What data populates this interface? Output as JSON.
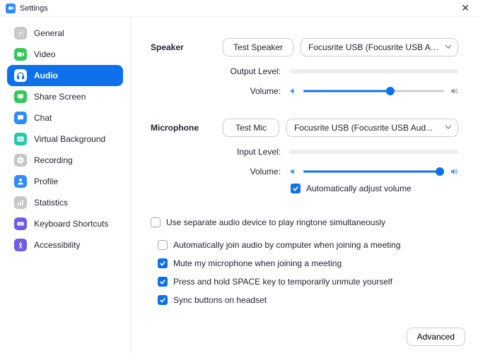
{
  "window": {
    "title": "Settings"
  },
  "sidebar": {
    "items": [
      {
        "label": "General",
        "icon": "gear",
        "color": "#C7C7C7"
      },
      {
        "label": "Video",
        "icon": "video",
        "color": "#34C759"
      },
      {
        "label": "Audio",
        "icon": "headphones",
        "color": "#fff"
      },
      {
        "label": "Share Screen",
        "icon": "share",
        "color": "#34C759"
      },
      {
        "label": "Chat",
        "icon": "chat",
        "color": "#2D8CFF"
      },
      {
        "label": "Virtual Background",
        "icon": "virtualbg",
        "color": "#23C9A9"
      },
      {
        "label": "Recording",
        "icon": "recording",
        "color": "#C7C7C7"
      },
      {
        "label": "Profile",
        "icon": "profile",
        "color": "#2D8CFF"
      },
      {
        "label": "Statistics",
        "icon": "statistics",
        "color": "#C7C7C7"
      },
      {
        "label": "Keyboard Shortcuts",
        "icon": "keyboard",
        "color": "#6E5CE6"
      },
      {
        "label": "Accessibility",
        "icon": "accessibility",
        "color": "#6E5CE6"
      }
    ],
    "active_index": 2
  },
  "speaker": {
    "label": "Speaker",
    "test_btn": "Test Speaker",
    "device": "Focusrite USB (Focusrite USB Aud...",
    "output_level_label": "Output Level:",
    "volume_label": "Volume:",
    "volume_percent": 62
  },
  "microphone": {
    "label": "Microphone",
    "test_btn": "Test Mic",
    "device": "Focusrite USB (Focusrite USB Aud...",
    "input_level_label": "Input Level:",
    "volume_label": "Volume:",
    "volume_percent": 97,
    "auto_adjust": {
      "label": "Automatically adjust volume",
      "checked": true
    }
  },
  "options": {
    "separate_ringtone": {
      "label": "Use separate audio device to play ringtone simultaneously",
      "checked": false
    },
    "auto_join_audio": {
      "label": "Automatically join audio by computer when joining a meeting",
      "checked": false
    },
    "mute_on_join": {
      "label": "Mute my microphone when joining a meeting",
      "checked": true
    },
    "space_unmute": {
      "label": "Press and hold SPACE key to temporarily unmute yourself",
      "checked": true
    },
    "sync_headset": {
      "label": "Sync buttons on headset",
      "checked": true
    }
  },
  "advanced_btn": "Advanced"
}
